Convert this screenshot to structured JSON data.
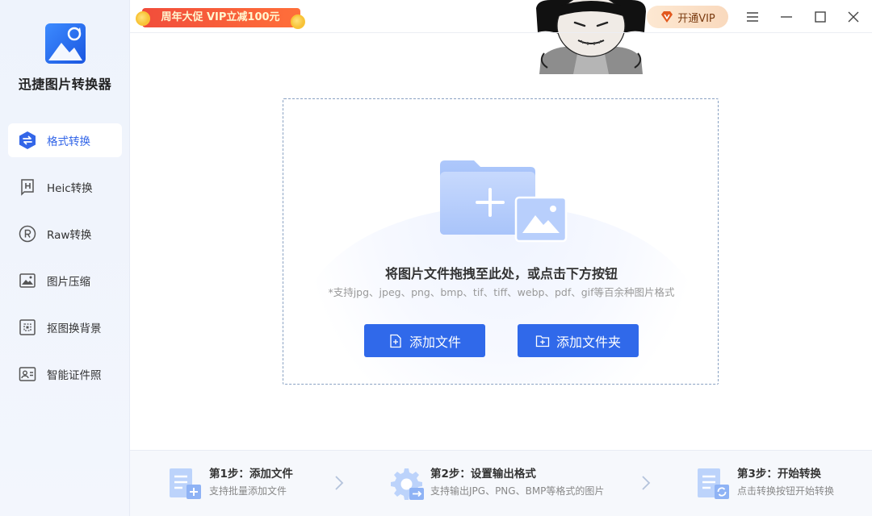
{
  "app": {
    "name": "迅捷图片转换器"
  },
  "sidebar": {
    "items": [
      {
        "label": "格式转换",
        "icon": "format-convert-icon",
        "active": true
      },
      {
        "label": "Heic转换",
        "icon": "heic-icon",
        "active": false
      },
      {
        "label": "Raw转换",
        "icon": "raw-icon",
        "active": false
      },
      {
        "label": "图片压缩",
        "icon": "image-compress-icon",
        "active": false
      },
      {
        "label": "抠图换背景",
        "icon": "cutout-icon",
        "active": false
      },
      {
        "label": "智能证件照",
        "icon": "id-photo-icon",
        "active": false
      }
    ]
  },
  "topbar": {
    "promo_text": "周年大促 VIP立减100元",
    "vip_label": "开通VIP"
  },
  "dropzone": {
    "title": "将图片文件拖拽至此处，或点击下方按钮",
    "subtitle": "*支持jpg、jpeg、png、bmp、tif、tiff、webp、pdf、gif等百余种图片格式",
    "add_file_label": "添加文件",
    "add_folder_label": "添加文件夹"
  },
  "steps": [
    {
      "title": "第1步：添加文件",
      "desc": "支持批量添加文件"
    },
    {
      "title": "第2步：设置输出格式",
      "desc": "支持输出JPG、PNG、BMP等格式的图片"
    },
    {
      "title": "第3步：开始转换",
      "desc": "点击转换按钮开始转换"
    }
  ],
  "colors": {
    "accent": "#3069ea",
    "sidebar_bg": "#eef3fc",
    "promo": "#f14d3b"
  }
}
